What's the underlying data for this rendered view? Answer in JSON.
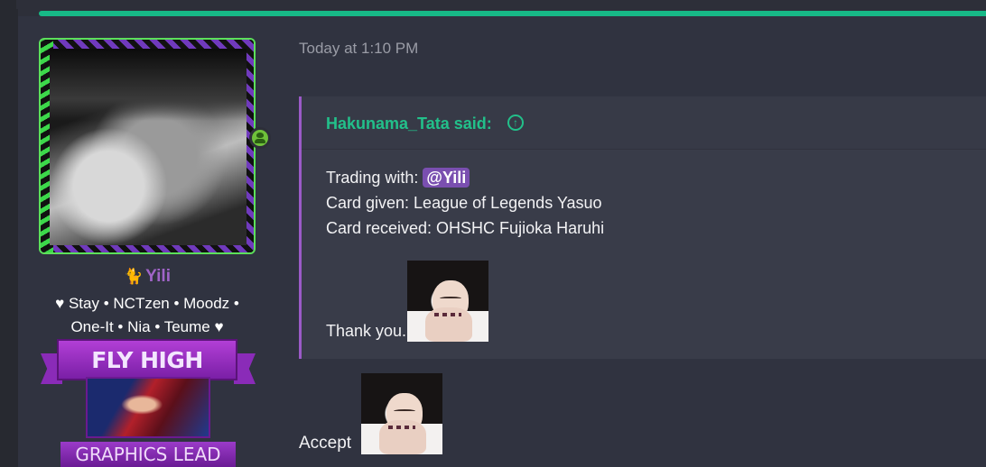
{
  "user": {
    "name": "Yili",
    "name_icon": "cat-icon",
    "title_lines": [
      "♥ Stay • NCTzen • Moodz •",
      "One-It • Nia • Teume ♥"
    ],
    "online_icon": "online-user-icon",
    "banner": {
      "title": "FLY HIGH",
      "subtitle": "GRAPHICS LEAD"
    }
  },
  "post": {
    "timestamp": "Today at 1:10 PM",
    "quote": {
      "author_label": "Hakunama_Tata said:",
      "jump_icon": "arrow-up-circle-icon",
      "trading_prefix": "Trading with: ",
      "mention": "@Yili",
      "card_given": "Card given: League of Legends Yasuo",
      "card_received": "Card received: OHSHC Fujioka Haruhi",
      "thanks": "Thank you."
    },
    "reply_text": "Accept"
  },
  "colors": {
    "accent_green": "#17b987",
    "quote_author": "#22c08a",
    "username": "#a064c8",
    "quote_border": "#9b5ac7",
    "mention_bg": "#7a4fb0",
    "background": "#2d2f39"
  }
}
